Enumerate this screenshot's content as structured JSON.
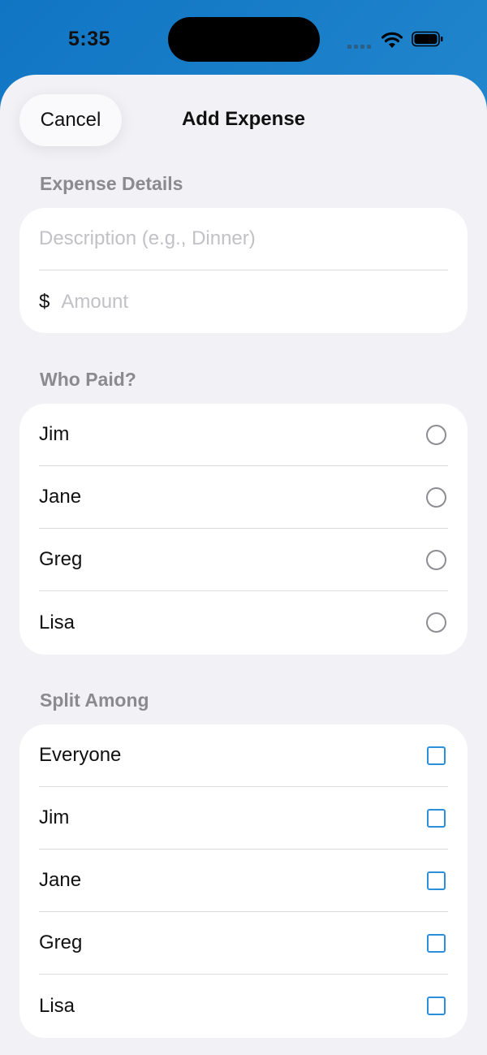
{
  "status_bar": {
    "time": "5:35"
  },
  "header": {
    "cancel_label": "Cancel",
    "title": "Add Expense"
  },
  "expense_details": {
    "header": "Expense Details",
    "description_placeholder": "Description (e.g., Dinner)",
    "currency_symbol": "$",
    "amount_placeholder": "Amount"
  },
  "who_paid": {
    "header": "Who Paid?",
    "options": [
      "Jim",
      "Jane",
      "Greg",
      "Lisa"
    ]
  },
  "split_among": {
    "header": "Split Among",
    "options": [
      "Everyone",
      "Jim",
      "Jane",
      "Greg",
      "Lisa"
    ]
  },
  "colors": {
    "accent": "#2b8fd9",
    "sheet_background": "#f1f1f6",
    "card_background": "#ffffff",
    "section_header": "#8a8a8f",
    "placeholder": "#c1c1c6"
  }
}
